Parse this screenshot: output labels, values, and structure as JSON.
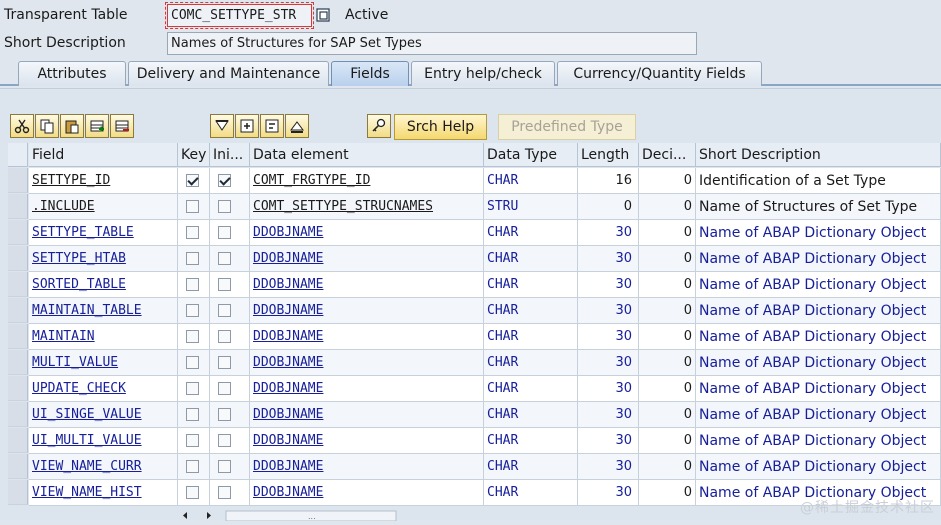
{
  "header": {
    "transparent_table_label": "Transparent Table",
    "table_name": "COMC_SETTYPE_STR",
    "status": "Active",
    "short_description_label": "Short Description",
    "short_description": "Names of Structures for SAP Set Types"
  },
  "tabs": [
    {
      "label": "Attributes",
      "active": false
    },
    {
      "label": "Delivery and Maintenance",
      "active": false
    },
    {
      "label": "Fields",
      "active": true
    },
    {
      "label": "Entry help/check",
      "active": false
    },
    {
      "label": "Currency/Quantity Fields",
      "active": false
    }
  ],
  "toolbar": {
    "icons": [
      "cut-icon",
      "copy-icon",
      "paste-icon",
      "insert-row-icon",
      "delete-row-icon",
      "filter-icon",
      "expand-icon",
      "collapse-icon",
      "up-icon",
      "search-help-icon"
    ],
    "srch_help_label": "Srch Help",
    "predefined_type_label": "Predefined Type"
  },
  "table": {
    "columns": [
      "Field",
      "Key",
      "Ini...",
      "Data element",
      "Data Type",
      "Length",
      "Deci...",
      "Short Description"
    ],
    "rows": [
      {
        "field": "SETTYPE_ID",
        "key": true,
        "ini": true,
        "data_element": "COMT_FRGTYPE_ID",
        "data_type": "CHAR",
        "length": "16",
        "deci": "0",
        "short_description": "Identification of a Set Type",
        "field_link": false,
        "de_link": false
      },
      {
        "field": ".INCLUDE",
        "key": false,
        "ini": false,
        "data_element": "COMT_SETTYPE_STRUCNAMES",
        "data_type": "STRU",
        "length": "0",
        "deci": "0",
        "short_description": "Name of Structures of Set Type",
        "field_link": false,
        "de_link": false
      },
      {
        "field": "SETTYPE_TABLE",
        "key": false,
        "ini": false,
        "data_element": "DDOBJNAME",
        "data_type": "CHAR",
        "length": "30",
        "deci": "0",
        "short_description": "Name of ABAP Dictionary Object",
        "field_link": true,
        "de_link": true
      },
      {
        "field": "SETTYPE_HTAB",
        "key": false,
        "ini": false,
        "data_element": "DDOBJNAME",
        "data_type": "CHAR",
        "length": "30",
        "deci": "0",
        "short_description": "Name of ABAP Dictionary Object",
        "field_link": true,
        "de_link": true
      },
      {
        "field": "SORTED_TABLE",
        "key": false,
        "ini": false,
        "data_element": "DDOBJNAME",
        "data_type": "CHAR",
        "length": "30",
        "deci": "0",
        "short_description": "Name of ABAP Dictionary Object",
        "field_link": true,
        "de_link": true
      },
      {
        "field": "MAINTAIN_TABLE",
        "key": false,
        "ini": false,
        "data_element": "DDOBJNAME",
        "data_type": "CHAR",
        "length": "30",
        "deci": "0",
        "short_description": "Name of ABAP Dictionary Object",
        "field_link": true,
        "de_link": true
      },
      {
        "field": "MAINTAIN",
        "key": false,
        "ini": false,
        "data_element": "DDOBJNAME",
        "data_type": "CHAR",
        "length": "30",
        "deci": "0",
        "short_description": "Name of ABAP Dictionary Object",
        "field_link": true,
        "de_link": true
      },
      {
        "field": "MULTI_VALUE",
        "key": false,
        "ini": false,
        "data_element": "DDOBJNAME",
        "data_type": "CHAR",
        "length": "30",
        "deci": "0",
        "short_description": "Name of ABAP Dictionary Object",
        "field_link": true,
        "de_link": true
      },
      {
        "field": "UPDATE_CHECK",
        "key": false,
        "ini": false,
        "data_element": "DDOBJNAME",
        "data_type": "CHAR",
        "length": "30",
        "deci": "0",
        "short_description": "Name of ABAP Dictionary Object",
        "field_link": true,
        "de_link": true
      },
      {
        "field": "UI_SINGE_VALUE",
        "key": false,
        "ini": false,
        "data_element": "DDOBJNAME",
        "data_type": "CHAR",
        "length": "30",
        "deci": "0",
        "short_description": "Name of ABAP Dictionary Object",
        "field_link": true,
        "de_link": true
      },
      {
        "field": "UI_MULTI_VALUE",
        "key": false,
        "ini": false,
        "data_element": "DDOBJNAME",
        "data_type": "CHAR",
        "length": "30",
        "deci": "0",
        "short_description": "Name of ABAP Dictionary Object",
        "field_link": true,
        "de_link": true
      },
      {
        "field": "VIEW_NAME_CURR",
        "key": false,
        "ini": false,
        "data_element": "DDOBJNAME",
        "data_type": "CHAR",
        "length": "30",
        "deci": "0",
        "short_description": "Name of ABAP Dictionary Object",
        "field_link": true,
        "de_link": true
      },
      {
        "field": "VIEW_NAME_HIST",
        "key": false,
        "ini": false,
        "data_element": "DDOBJNAME",
        "data_type": "CHAR",
        "length": "30",
        "deci": "0",
        "short_description": "Name of ABAP Dictionary Object",
        "field_link": true,
        "de_link": true
      }
    ]
  },
  "watermark": "@稀土掘金技术社区",
  "colors": {
    "link": "#17209a",
    "background": "#dfe6ee",
    "button": "#f5d86f"
  }
}
